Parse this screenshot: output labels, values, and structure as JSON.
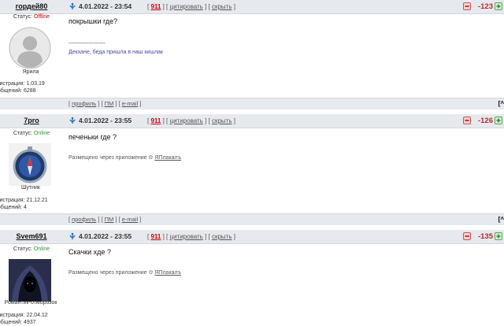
{
  "posts": [
    {
      "author": "гордей80",
      "date": "4.01.2022 - 23:54",
      "num": "911",
      "quote": "цитировать",
      "hide": "скрыть",
      "rating": "-123",
      "status_label": "Статус:",
      "status": "Offline",
      "avatar_name": "Ярила",
      "reg": "егистрация: 1.03.19",
      "msgs": "ообщений: 6288",
      "message": "покрышки где?",
      "sig_line": "--------------------",
      "sig": "Декхане, беда пришла в наш кишлак"
    },
    {
      "author": "7pro",
      "date": "4.01.2022 - 23:55",
      "num": "911",
      "quote": "цитировать",
      "hide": "скрыть",
      "rating": "-126",
      "status_label": "Статус:",
      "status": "Online",
      "avatar_name": "Шутник",
      "reg": "егистрация: 21.12.21",
      "msgs": "ообщений: 4",
      "message": "печеньки где ?",
      "sig_prefix": "Размещено через приложение",
      "sig_app": "ЯПлакалъ"
    },
    {
      "author": "Svem691",
      "date": "4.01.2022 - 23:55",
      "num": "911",
      "quote": "цитировать",
      "hide": "скрыть",
      "rating": "-135",
      "status_label": "Статус:",
      "status": "Online",
      "avatar_name": "Романтик-отморозок",
      "reg": "егистрация: 22.04.12",
      "msgs": "ообщений: 4937",
      "message": "Скачки хде ?",
      "sig_prefix": "Размещено через приложение",
      "sig_app": "ЯПлакалъ"
    }
  ],
  "footer": {
    "profile": "профиль",
    "pm": "ПМ",
    "email": "e-mail",
    "top": "[^"
  },
  "colors": {
    "header_bg": "#e6e9ee",
    "offline": "#cc0000",
    "online": "#2a9a2a",
    "rating": "#c1272d"
  }
}
